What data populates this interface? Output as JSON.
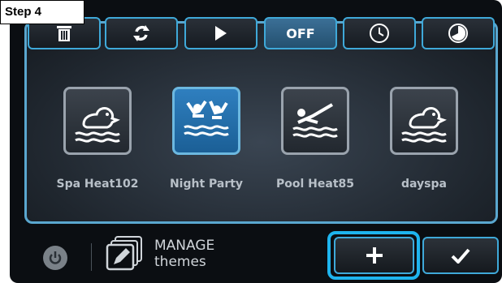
{
  "step_label": "Step 4",
  "toolbar": {
    "delete_icon": "trash-icon",
    "refresh_icon": "refresh-icon",
    "play_icon": "play-icon",
    "off_label": "OFF",
    "clock_icon": "clock-icon",
    "timer_icon": "timer-icon"
  },
  "themes": [
    {
      "label": "Spa Heat102",
      "icon": "duck-icon",
      "selected": false
    },
    {
      "label": "Night Party",
      "icon": "party-swimmers-icon",
      "selected": true
    },
    {
      "label": "Pool Heat85",
      "icon": "swimmer-icon",
      "selected": false
    },
    {
      "label": "dayspa",
      "icon": "duck-icon",
      "selected": false
    }
  ],
  "bottom": {
    "power_icon": "power-icon",
    "manage_line1": "MANAGE",
    "manage_line2": "themes",
    "add_icon": "plus-icon",
    "confirm_icon": "checkmark-icon"
  },
  "colors": {
    "accent": "#3fa9d9",
    "highlight": "#1eb4ee",
    "selected_tile": "#2f7fbf"
  }
}
